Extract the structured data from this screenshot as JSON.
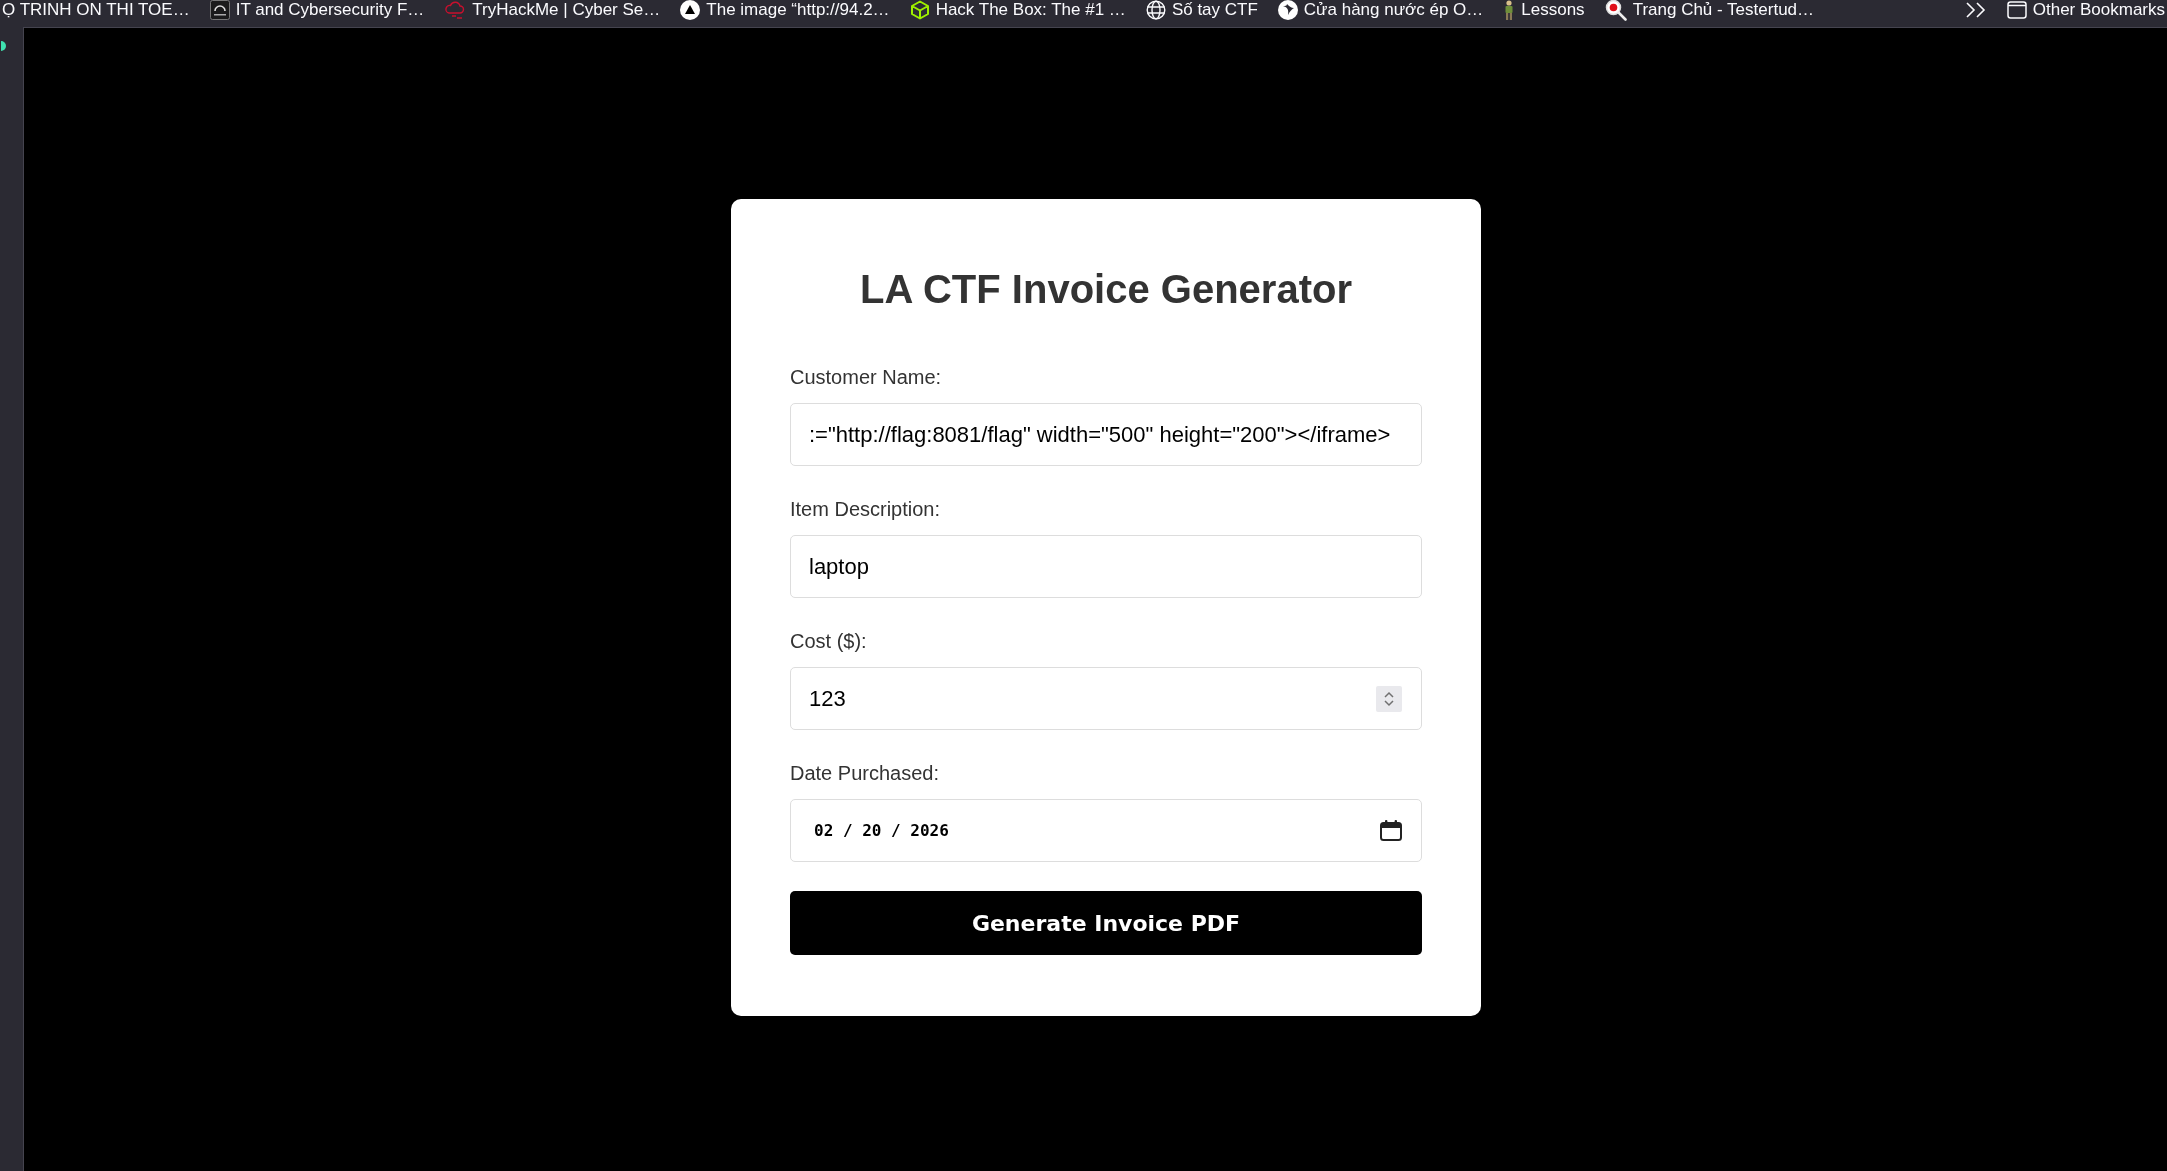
{
  "bookmarks_bar": {
    "items": [
      {
        "label": "Ọ TRINH ON THI TOE…"
      },
      {
        "label": "IT and Cybersecurity F…"
      },
      {
        "label": "TryHackMe | Cyber Se…"
      },
      {
        "label": "The image “http://94.2…"
      },
      {
        "label": "Hack The Box: The #1 …"
      },
      {
        "label": "Số tay CTF"
      },
      {
        "label": "Cửa hàng nước ép O…"
      },
      {
        "label": "Lessons"
      },
      {
        "label": "Trang Chủ - Testertud…"
      }
    ],
    "other_bookmarks": {
      "label": "Other Bookmarks"
    }
  },
  "invoice_form": {
    "title": "LA CTF Invoice Generator",
    "fields": [
      {
        "kind": "text",
        "label": "Customer Name:",
        "value": ":=\"http://flag:8081/flag\" width=\"500\" height=\"200\"></iframe>"
      },
      {
        "kind": "text",
        "label": "Item Description:",
        "value": "laptop"
      },
      {
        "kind": "number",
        "label": "Cost ($):",
        "value": "123"
      },
      {
        "kind": "date",
        "label": "Date Purchased:",
        "value": "02 / 20 / 2026"
      }
    ],
    "submit_button": {
      "label": "Generate Invoice PDF"
    }
  }
}
